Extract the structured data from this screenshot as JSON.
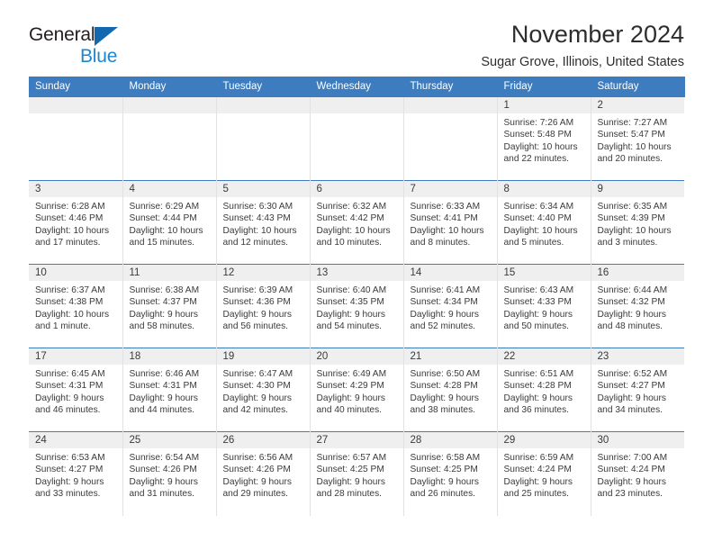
{
  "brand": {
    "name_top": "General",
    "name_bottom": "Blue",
    "triangle_color": "#1368b0",
    "blue_text_color": "#1c86d4"
  },
  "header": {
    "title": "November 2024",
    "subtitle": "Sugar Grove, Illinois, United States"
  },
  "theme": {
    "header_row_bg": "#3c7cbf",
    "daynum_bg": "#efefef",
    "week_divider": "#3c7cbf",
    "text": "#3a3a3a"
  },
  "weekdays": [
    "Sunday",
    "Monday",
    "Tuesday",
    "Wednesday",
    "Thursday",
    "Friday",
    "Saturday"
  ],
  "labels": {
    "sunrise_prefix": "Sunrise: ",
    "sunset_prefix": "Sunset: ",
    "daylight_prefix": "Daylight: "
  },
  "weeks": [
    [
      {
        "day": "",
        "empty": true
      },
      {
        "day": "",
        "empty": true
      },
      {
        "day": "",
        "empty": true
      },
      {
        "day": "",
        "empty": true
      },
      {
        "day": "",
        "empty": true
      },
      {
        "day": "1",
        "sunrise": "Sunrise: 7:26 AM",
        "sunset": "Sunset: 5:48 PM",
        "daylight": "Daylight: 10 hours and 22 minutes."
      },
      {
        "day": "2",
        "sunrise": "Sunrise: 7:27 AM",
        "sunset": "Sunset: 5:47 PM",
        "daylight": "Daylight: 10 hours and 20 minutes."
      }
    ],
    [
      {
        "day": "3",
        "sunrise": "Sunrise: 6:28 AM",
        "sunset": "Sunset: 4:46 PM",
        "daylight": "Daylight: 10 hours and 17 minutes."
      },
      {
        "day": "4",
        "sunrise": "Sunrise: 6:29 AM",
        "sunset": "Sunset: 4:44 PM",
        "daylight": "Daylight: 10 hours and 15 minutes."
      },
      {
        "day": "5",
        "sunrise": "Sunrise: 6:30 AM",
        "sunset": "Sunset: 4:43 PM",
        "daylight": "Daylight: 10 hours and 12 minutes."
      },
      {
        "day": "6",
        "sunrise": "Sunrise: 6:32 AM",
        "sunset": "Sunset: 4:42 PM",
        "daylight": "Daylight: 10 hours and 10 minutes."
      },
      {
        "day": "7",
        "sunrise": "Sunrise: 6:33 AM",
        "sunset": "Sunset: 4:41 PM",
        "daylight": "Daylight: 10 hours and 8 minutes."
      },
      {
        "day": "8",
        "sunrise": "Sunrise: 6:34 AM",
        "sunset": "Sunset: 4:40 PM",
        "daylight": "Daylight: 10 hours and 5 minutes."
      },
      {
        "day": "9",
        "sunrise": "Sunrise: 6:35 AM",
        "sunset": "Sunset: 4:39 PM",
        "daylight": "Daylight: 10 hours and 3 minutes."
      }
    ],
    [
      {
        "day": "10",
        "sunrise": "Sunrise: 6:37 AM",
        "sunset": "Sunset: 4:38 PM",
        "daylight": "Daylight: 10 hours and 1 minute."
      },
      {
        "day": "11",
        "sunrise": "Sunrise: 6:38 AM",
        "sunset": "Sunset: 4:37 PM",
        "daylight": "Daylight: 9 hours and 58 minutes."
      },
      {
        "day": "12",
        "sunrise": "Sunrise: 6:39 AM",
        "sunset": "Sunset: 4:36 PM",
        "daylight": "Daylight: 9 hours and 56 minutes."
      },
      {
        "day": "13",
        "sunrise": "Sunrise: 6:40 AM",
        "sunset": "Sunset: 4:35 PM",
        "daylight": "Daylight: 9 hours and 54 minutes."
      },
      {
        "day": "14",
        "sunrise": "Sunrise: 6:41 AM",
        "sunset": "Sunset: 4:34 PM",
        "daylight": "Daylight: 9 hours and 52 minutes."
      },
      {
        "day": "15",
        "sunrise": "Sunrise: 6:43 AM",
        "sunset": "Sunset: 4:33 PM",
        "daylight": "Daylight: 9 hours and 50 minutes."
      },
      {
        "day": "16",
        "sunrise": "Sunrise: 6:44 AM",
        "sunset": "Sunset: 4:32 PM",
        "daylight": "Daylight: 9 hours and 48 minutes."
      }
    ],
    [
      {
        "day": "17",
        "sunrise": "Sunrise: 6:45 AM",
        "sunset": "Sunset: 4:31 PM",
        "daylight": "Daylight: 9 hours and 46 minutes."
      },
      {
        "day": "18",
        "sunrise": "Sunrise: 6:46 AM",
        "sunset": "Sunset: 4:31 PM",
        "daylight": "Daylight: 9 hours and 44 minutes."
      },
      {
        "day": "19",
        "sunrise": "Sunrise: 6:47 AM",
        "sunset": "Sunset: 4:30 PM",
        "daylight": "Daylight: 9 hours and 42 minutes."
      },
      {
        "day": "20",
        "sunrise": "Sunrise: 6:49 AM",
        "sunset": "Sunset: 4:29 PM",
        "daylight": "Daylight: 9 hours and 40 minutes."
      },
      {
        "day": "21",
        "sunrise": "Sunrise: 6:50 AM",
        "sunset": "Sunset: 4:28 PM",
        "daylight": "Daylight: 9 hours and 38 minutes."
      },
      {
        "day": "22",
        "sunrise": "Sunrise: 6:51 AM",
        "sunset": "Sunset: 4:28 PM",
        "daylight": "Daylight: 9 hours and 36 minutes."
      },
      {
        "day": "23",
        "sunrise": "Sunrise: 6:52 AM",
        "sunset": "Sunset: 4:27 PM",
        "daylight": "Daylight: 9 hours and 34 minutes."
      }
    ],
    [
      {
        "day": "24",
        "sunrise": "Sunrise: 6:53 AM",
        "sunset": "Sunset: 4:27 PM",
        "daylight": "Daylight: 9 hours and 33 minutes."
      },
      {
        "day": "25",
        "sunrise": "Sunrise: 6:54 AM",
        "sunset": "Sunset: 4:26 PM",
        "daylight": "Daylight: 9 hours and 31 minutes."
      },
      {
        "day": "26",
        "sunrise": "Sunrise: 6:56 AM",
        "sunset": "Sunset: 4:26 PM",
        "daylight": "Daylight: 9 hours and 29 minutes."
      },
      {
        "day": "27",
        "sunrise": "Sunrise: 6:57 AM",
        "sunset": "Sunset: 4:25 PM",
        "daylight": "Daylight: 9 hours and 28 minutes."
      },
      {
        "day": "28",
        "sunrise": "Sunrise: 6:58 AM",
        "sunset": "Sunset: 4:25 PM",
        "daylight": "Daylight: 9 hours and 26 minutes."
      },
      {
        "day": "29",
        "sunrise": "Sunrise: 6:59 AM",
        "sunset": "Sunset: 4:24 PM",
        "daylight": "Daylight: 9 hours and 25 minutes."
      },
      {
        "day": "30",
        "sunrise": "Sunrise: 7:00 AM",
        "sunset": "Sunset: 4:24 PM",
        "daylight": "Daylight: 9 hours and 23 minutes."
      }
    ]
  ]
}
